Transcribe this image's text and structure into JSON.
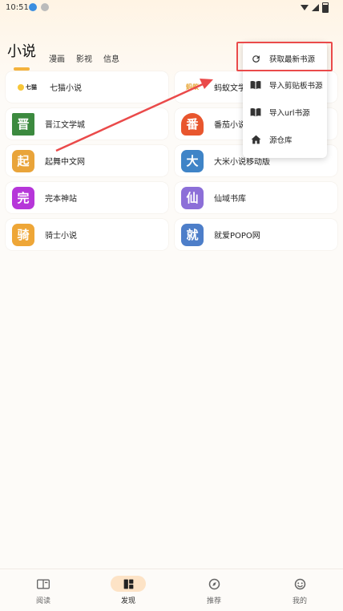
{
  "status": {
    "time": "10:51"
  },
  "tabs": [
    {
      "label": "小说",
      "active": true
    },
    {
      "label": "漫画"
    },
    {
      "label": "影视"
    },
    {
      "label": "信息"
    }
  ],
  "sources": [
    {
      "name": "七猫小说",
      "logo_text": "七猫",
      "logo_color": "#ffffff",
      "icon": "qimao-logo"
    },
    {
      "name": "蚂蚁文学",
      "logo_text": "蚂蚁",
      "logo_color": "#ffffff",
      "icon": "mayi-logo"
    },
    {
      "name": "晋江文学城",
      "logo_text": "晋",
      "logo_color": "#3c8a3f",
      "icon": "jinjiang-logo"
    },
    {
      "name": "番茄小说",
      "logo_text": "番",
      "logo_color": "#e8562e",
      "icon": "fanqie-logo"
    },
    {
      "name": "起舞中文网",
      "logo_text": "起",
      "logo_color": "#e9a43a",
      "icon": "qiwu-logo"
    },
    {
      "name": "大米小说移动版",
      "logo_text": "大",
      "logo_color": "#3f84c7",
      "icon": "dami-logo"
    },
    {
      "name": "完本神站",
      "logo_text": "完",
      "logo_color": "#b636d9",
      "icon": "wanben-logo"
    },
    {
      "name": "仙域书库",
      "logo_text": "仙",
      "logo_color": "#8c6fd8",
      "icon": "xianyu-logo"
    },
    {
      "name": "骑士小说",
      "logo_text": "骑",
      "logo_color": "#eea637",
      "icon": "qishi-logo"
    },
    {
      "name": "就爱POPO网",
      "logo_text": "就",
      "logo_color": "#4d7ec9",
      "icon": "popo-logo"
    }
  ],
  "menu": {
    "items": [
      {
        "label": "获取最新书源",
        "icon": "refresh-icon"
      },
      {
        "label": "导入剪贴板书源",
        "icon": "book-icon"
      },
      {
        "label": "导入url书源",
        "icon": "book-icon"
      },
      {
        "label": "源仓库",
        "icon": "home-icon"
      }
    ]
  },
  "bottom_nav": [
    {
      "label": "阅读",
      "icon": "book-open-icon"
    },
    {
      "label": "发现",
      "icon": "dashboard-icon",
      "active": true
    },
    {
      "label": "推荐",
      "icon": "compass-icon"
    },
    {
      "label": "我的",
      "icon": "face-icon"
    }
  ],
  "colors": {
    "accent": "#f4b23c",
    "highlight": "#ea4a4a",
    "active_tab_bg": "#fde3c6"
  }
}
